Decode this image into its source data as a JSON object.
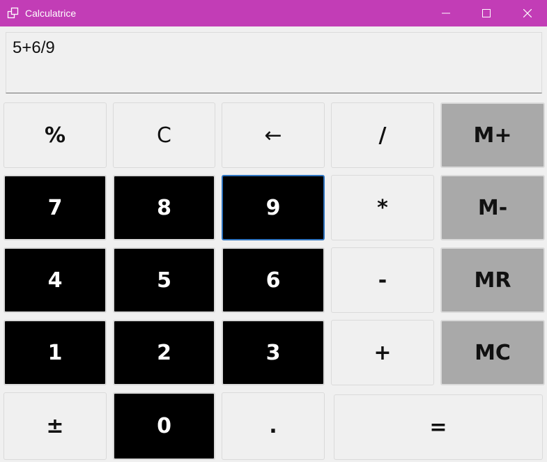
{
  "window": {
    "title": "Calculatrice"
  },
  "display": {
    "expression": "5+6/9"
  },
  "buttons": {
    "percent": "%",
    "clear": "C",
    "backspace": "←",
    "divide": "/",
    "mem_add": "M+",
    "seven": "7",
    "eight": "8",
    "nine": "9",
    "multiply": "*",
    "mem_sub": "M-",
    "four": "4",
    "five": "5",
    "six": "6",
    "minus": "-",
    "mem_recall": "MR",
    "one": "1",
    "two": "2",
    "three": "3",
    "plus": "+",
    "mem_clear": "MC",
    "plus_minus": "±",
    "zero": "0",
    "decimal": ".",
    "equals": "="
  },
  "colors": {
    "titlebar": "#c23db6",
    "digit_bg": "#000000",
    "memory_bg": "#a9a9a9",
    "operator_bg": "#f0f0f0",
    "focus_border": "#2f74c0"
  },
  "icons": {
    "app": "calculator-app-icon",
    "minimize": "minimize-icon",
    "maximize": "maximize-icon",
    "close": "close-icon"
  }
}
